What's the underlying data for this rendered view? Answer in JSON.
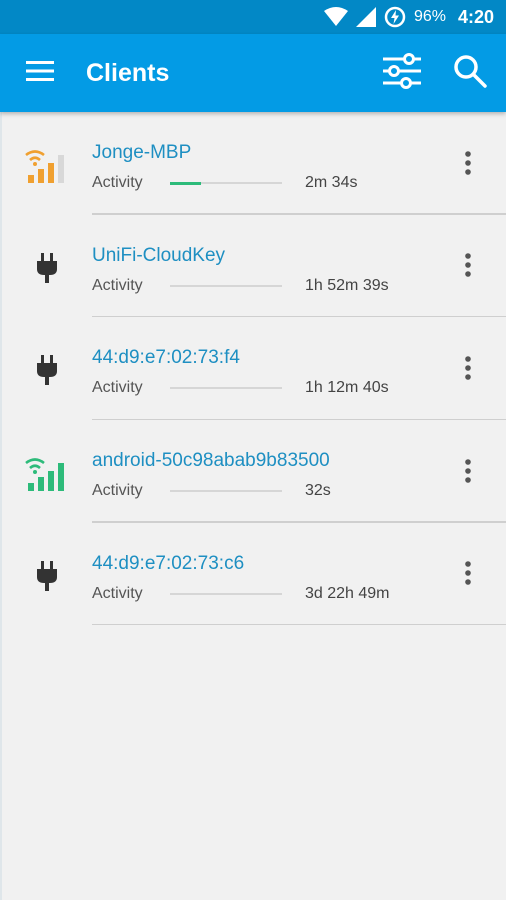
{
  "status_bar": {
    "battery_percent": "96%",
    "time": "4:20",
    "icons": [
      "wifi-icon",
      "cell-signal-icon",
      "battery-charging-icon"
    ]
  },
  "app_bar": {
    "title": "Clients",
    "icons": [
      "menu-icon",
      "filter-icon",
      "search-icon"
    ]
  },
  "colors": {
    "status_bar": "#0288c6",
    "app_bar": "#039be5",
    "client_name": "#1e8fc2",
    "wifi_fair": "#f0a030",
    "wifi_good": "#2dbb7a",
    "activity_fill": "#2dbb7a"
  },
  "clients": [
    {
      "name": "Jonge-MBP",
      "activity_label": "Activity",
      "uptime": "2m 34s",
      "connection": "wifi",
      "signal_bars": 3,
      "signal_color": "orange",
      "activity_level": 0.28
    },
    {
      "name": "UniFi-CloudKey",
      "activity_label": "Activity",
      "uptime": "1h 52m 39s",
      "connection": "wired",
      "activity_level": 0
    },
    {
      "name": "44:d9:e7:02:73:f4",
      "activity_label": "Activity",
      "uptime": "1h 12m 40s",
      "connection": "wired",
      "activity_level": 0
    },
    {
      "name": "android-50c98abab9b83500",
      "activity_label": "Activity",
      "uptime": "32s",
      "connection": "wifi",
      "signal_bars": 4,
      "signal_color": "green",
      "activity_level": 0
    },
    {
      "name": "44:d9:e7:02:73:c6",
      "activity_label": "Activity",
      "uptime": "3d 22h 49m",
      "connection": "wired",
      "activity_level": 0
    }
  ]
}
